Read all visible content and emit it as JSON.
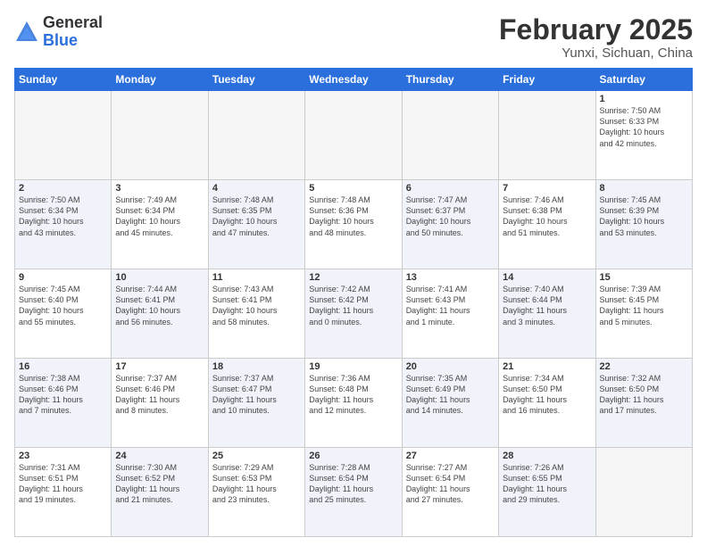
{
  "logo": {
    "general": "General",
    "blue": "Blue"
  },
  "header": {
    "month": "February 2025",
    "location": "Yunxi, Sichuan, China"
  },
  "weekdays": [
    "Sunday",
    "Monday",
    "Tuesday",
    "Wednesday",
    "Thursday",
    "Friday",
    "Saturday"
  ],
  "weeks": [
    [
      {
        "day": "",
        "info": "",
        "shade": false,
        "empty": true
      },
      {
        "day": "",
        "info": "",
        "shade": false,
        "empty": true
      },
      {
        "day": "",
        "info": "",
        "shade": false,
        "empty": true
      },
      {
        "day": "",
        "info": "",
        "shade": false,
        "empty": true
      },
      {
        "day": "",
        "info": "",
        "shade": false,
        "empty": true
      },
      {
        "day": "",
        "info": "",
        "shade": false,
        "empty": true
      },
      {
        "day": "1",
        "info": "Sunrise: 7:50 AM\nSunset: 6:33 PM\nDaylight: 10 hours\nand 42 minutes.",
        "shade": false,
        "empty": false
      }
    ],
    [
      {
        "day": "2",
        "info": "Sunrise: 7:50 AM\nSunset: 6:34 PM\nDaylight: 10 hours\nand 43 minutes.",
        "shade": true,
        "empty": false
      },
      {
        "day": "3",
        "info": "Sunrise: 7:49 AM\nSunset: 6:34 PM\nDaylight: 10 hours\nand 45 minutes.",
        "shade": false,
        "empty": false
      },
      {
        "day": "4",
        "info": "Sunrise: 7:48 AM\nSunset: 6:35 PM\nDaylight: 10 hours\nand 47 minutes.",
        "shade": true,
        "empty": false
      },
      {
        "day": "5",
        "info": "Sunrise: 7:48 AM\nSunset: 6:36 PM\nDaylight: 10 hours\nand 48 minutes.",
        "shade": false,
        "empty": false
      },
      {
        "day": "6",
        "info": "Sunrise: 7:47 AM\nSunset: 6:37 PM\nDaylight: 10 hours\nand 50 minutes.",
        "shade": true,
        "empty": false
      },
      {
        "day": "7",
        "info": "Sunrise: 7:46 AM\nSunset: 6:38 PM\nDaylight: 10 hours\nand 51 minutes.",
        "shade": false,
        "empty": false
      },
      {
        "day": "8",
        "info": "Sunrise: 7:45 AM\nSunset: 6:39 PM\nDaylight: 10 hours\nand 53 minutes.",
        "shade": true,
        "empty": false
      }
    ],
    [
      {
        "day": "9",
        "info": "Sunrise: 7:45 AM\nSunset: 6:40 PM\nDaylight: 10 hours\nand 55 minutes.",
        "shade": false,
        "empty": false
      },
      {
        "day": "10",
        "info": "Sunrise: 7:44 AM\nSunset: 6:41 PM\nDaylight: 10 hours\nand 56 minutes.",
        "shade": true,
        "empty": false
      },
      {
        "day": "11",
        "info": "Sunrise: 7:43 AM\nSunset: 6:41 PM\nDaylight: 10 hours\nand 58 minutes.",
        "shade": false,
        "empty": false
      },
      {
        "day": "12",
        "info": "Sunrise: 7:42 AM\nSunset: 6:42 PM\nDaylight: 11 hours\nand 0 minutes.",
        "shade": true,
        "empty": false
      },
      {
        "day": "13",
        "info": "Sunrise: 7:41 AM\nSunset: 6:43 PM\nDaylight: 11 hours\nand 1 minute.",
        "shade": false,
        "empty": false
      },
      {
        "day": "14",
        "info": "Sunrise: 7:40 AM\nSunset: 6:44 PM\nDaylight: 11 hours\nand 3 minutes.",
        "shade": true,
        "empty": false
      },
      {
        "day": "15",
        "info": "Sunrise: 7:39 AM\nSunset: 6:45 PM\nDaylight: 11 hours\nand 5 minutes.",
        "shade": false,
        "empty": false
      }
    ],
    [
      {
        "day": "16",
        "info": "Sunrise: 7:38 AM\nSunset: 6:46 PM\nDaylight: 11 hours\nand 7 minutes.",
        "shade": true,
        "empty": false
      },
      {
        "day": "17",
        "info": "Sunrise: 7:37 AM\nSunset: 6:46 PM\nDaylight: 11 hours\nand 8 minutes.",
        "shade": false,
        "empty": false
      },
      {
        "day": "18",
        "info": "Sunrise: 7:37 AM\nSunset: 6:47 PM\nDaylight: 11 hours\nand 10 minutes.",
        "shade": true,
        "empty": false
      },
      {
        "day": "19",
        "info": "Sunrise: 7:36 AM\nSunset: 6:48 PM\nDaylight: 11 hours\nand 12 minutes.",
        "shade": false,
        "empty": false
      },
      {
        "day": "20",
        "info": "Sunrise: 7:35 AM\nSunset: 6:49 PM\nDaylight: 11 hours\nand 14 minutes.",
        "shade": true,
        "empty": false
      },
      {
        "day": "21",
        "info": "Sunrise: 7:34 AM\nSunset: 6:50 PM\nDaylight: 11 hours\nand 16 minutes.",
        "shade": false,
        "empty": false
      },
      {
        "day": "22",
        "info": "Sunrise: 7:32 AM\nSunset: 6:50 PM\nDaylight: 11 hours\nand 17 minutes.",
        "shade": true,
        "empty": false
      }
    ],
    [
      {
        "day": "23",
        "info": "Sunrise: 7:31 AM\nSunset: 6:51 PM\nDaylight: 11 hours\nand 19 minutes.",
        "shade": false,
        "empty": false
      },
      {
        "day": "24",
        "info": "Sunrise: 7:30 AM\nSunset: 6:52 PM\nDaylight: 11 hours\nand 21 minutes.",
        "shade": true,
        "empty": false
      },
      {
        "day": "25",
        "info": "Sunrise: 7:29 AM\nSunset: 6:53 PM\nDaylight: 11 hours\nand 23 minutes.",
        "shade": false,
        "empty": false
      },
      {
        "day": "26",
        "info": "Sunrise: 7:28 AM\nSunset: 6:54 PM\nDaylight: 11 hours\nand 25 minutes.",
        "shade": true,
        "empty": false
      },
      {
        "day": "27",
        "info": "Sunrise: 7:27 AM\nSunset: 6:54 PM\nDaylight: 11 hours\nand 27 minutes.",
        "shade": false,
        "empty": false
      },
      {
        "day": "28",
        "info": "Sunrise: 7:26 AM\nSunset: 6:55 PM\nDaylight: 11 hours\nand 29 minutes.",
        "shade": true,
        "empty": false
      },
      {
        "day": "",
        "info": "",
        "shade": false,
        "empty": true
      }
    ]
  ]
}
